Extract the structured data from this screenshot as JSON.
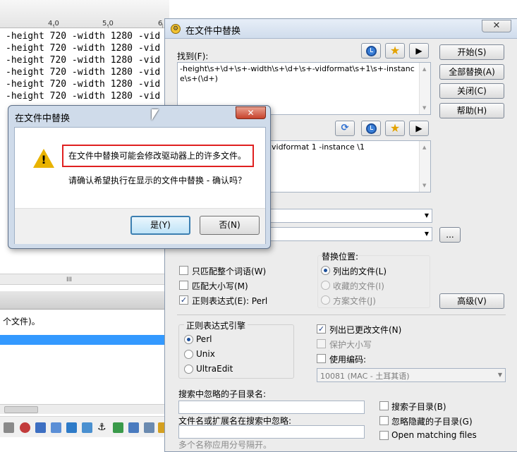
{
  "editor": {
    "ruler_labels": [
      "4,0",
      "5,0",
      "6"
    ],
    "code_lines": [
      "-height 720 -width 1280 -vid",
      "-height 720 -width 1280 -vid",
      "-height 720 -width 1280 -vid",
      "-height 720 -width 1280 -vid",
      "-height 720 -width 1280 -vid",
      "-height 720 -width 1280 -vid"
    ],
    "scroll_grip": "III",
    "output_text": "个文件)。"
  },
  "replace_dialog": {
    "title": "在文件中替换",
    "close_glyph": "✕",
    "find_label": "找到(F):",
    "find_value": "-height\\s+\\d+\\s+-width\\s+\\d+\\s+-vidformat\\s+1\\s+-instance\\s+(\\d+)",
    "replace_value": "vidformat 1 -instance \\1",
    "buttons": {
      "start": "开始(S)",
      "replace_all": "全部替换(A)",
      "close": "关闭(C)",
      "help": "帮助(H)",
      "advanced": "高级(V)",
      "browse": "..."
    },
    "options": {
      "whole_word": "只匹配整个词语(W)",
      "match_case": "匹配大小写(M)",
      "regex": "正则表达式(E): Perl"
    },
    "replace_location": {
      "title": "替换位置:",
      "listed_files": "列出的文件(L)",
      "favorite_files": "收藏的文件(I)",
      "project_files": "方案文件(J)"
    },
    "regex_engine": {
      "title": "正则表达式引擎",
      "perl": "Perl",
      "unix": "Unix",
      "ultraedit": "UltraEdit"
    },
    "list_changed": "列出已更改文件(N)",
    "keep_case": "保护大小写",
    "use_encoding": "使用编码:",
    "encoding_value": "10081 (MAC - 土耳其语)",
    "ignore_subdirs_label": "搜索中忽略的子目录名:",
    "ignore_files_label": "文件名或扩展名在搜索中忽略:",
    "search_subdirs": "搜索子目录(B)",
    "ignore_hidden": "忽略隐藏的子目录(G)",
    "open_matching": "Open matching files",
    "hint": "多个名称应用分号隔开。"
  },
  "confirm_dialog": {
    "title": "在文件中替换",
    "close_glyph": "✕",
    "message_line1": "在文件中替换可能会修改驱动器上的许多文件。",
    "message_line2": "请确认希望执行在显示的文件中替换 - 确认吗？",
    "yes": "是(Y)",
    "no": "否(N)"
  },
  "icons": [
    "warning-icon",
    "clock-history-icon",
    "star-favorite-icon",
    "play-icon",
    "refresh-icon"
  ],
  "colors": {
    "highlight_border": "#e02020",
    "selection": "#3399ff",
    "warning": "#e9b300",
    "close_red": "#c7422b"
  }
}
